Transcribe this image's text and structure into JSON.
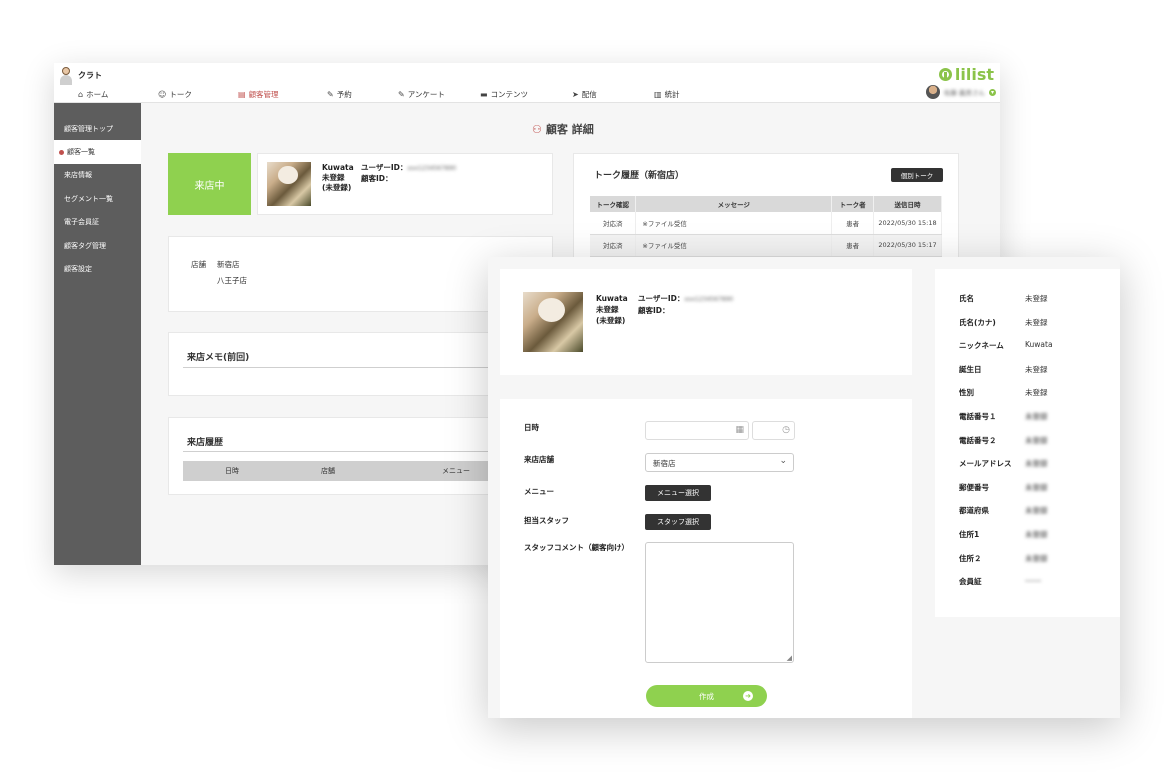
{
  "app": {
    "name": "クラト",
    "logo_text": "lilist",
    "user_name": "佐藤 義男さん"
  },
  "nav": [
    {
      "label": "ホーム",
      "icon": "home-icon",
      "glyph": "⌂"
    },
    {
      "label": "トーク",
      "icon": "chat-icon",
      "glyph": "☺"
    },
    {
      "label": "顧客管理",
      "icon": "customer-icon",
      "glyph": "▤"
    },
    {
      "label": "予約",
      "icon": "reservation-icon",
      "glyph": "✎"
    },
    {
      "label": "アンケート",
      "icon": "survey-icon",
      "glyph": "✎"
    },
    {
      "label": "コンテンツ",
      "icon": "folder-icon",
      "glyph": "▬"
    },
    {
      "label": "配信",
      "icon": "send-icon",
      "glyph": "➤"
    },
    {
      "label": "統計",
      "icon": "stats-icon",
      "glyph": "▥"
    }
  ],
  "sidebar": [
    "顧客管理トップ",
    "顧客一覧",
    "来店情報",
    "セグメント一覧",
    "電子会員証",
    "顧客タグ管理",
    "顧客設定"
  ],
  "page_title": "顧客 詳細",
  "visit_status_button": "来店中",
  "customer": {
    "name": "Kuwata",
    "registration_1": "未登録",
    "registration_2": "(未登録)",
    "user_id_label": "ユーザーID：",
    "user_id_value": "xxx1234567890",
    "customer_id_label": "顧客ID："
  },
  "store": {
    "label": "店舗",
    "values": [
      "新宿店",
      "八王子店"
    ]
  },
  "visit_memo_title": "来店メモ(前回)",
  "visit_history": {
    "title": "来店履歴",
    "columns": [
      "日時",
      "店舗",
      "メニュー"
    ]
  },
  "talk_history": {
    "title": "トーク履歴（新宿店）",
    "button": "個別トーク",
    "columns": [
      "トーク確認",
      "メッセージ",
      "トーク者",
      "送信日時"
    ],
    "rows": [
      {
        "status": "対応済",
        "message": "※ファイル受信",
        "sender": "患者",
        "datetime": "2022/05/30 15:18"
      },
      {
        "status": "対応済",
        "message": "※ファイル受信",
        "sender": "患者",
        "datetime": "2022/05/30 15:17"
      }
    ]
  },
  "visit_form": {
    "datetime_label": "日時",
    "store_label": "来店店舗",
    "store_value": "新宿店",
    "menu_label": "メニュー",
    "menu_button": "メニュー選択",
    "staff_label": "担当スタッフ",
    "staff_button": "スタッフ選択",
    "comment_label": "スタッフコメント（顧客向け）",
    "submit": "作成"
  },
  "profile": [
    {
      "key": "氏名",
      "value": "未登録",
      "blur": false
    },
    {
      "key": "氏名(カナ)",
      "value": "未登録",
      "blur": false
    },
    {
      "key": "ニックネーム",
      "value": "Kuwata",
      "blur": false
    },
    {
      "key": "誕生日",
      "value": "未登録",
      "blur": false
    },
    {
      "key": "性別",
      "value": "未登録",
      "blur": false
    },
    {
      "key": "電話番号１",
      "value": "未登録",
      "blur": true
    },
    {
      "key": "電話番号２",
      "value": "未登録",
      "blur": true
    },
    {
      "key": "メールアドレス",
      "value": "未登録",
      "blur": true
    },
    {
      "key": "郵便番号",
      "value": "未登録",
      "blur": true
    },
    {
      "key": "都道府県",
      "value": "未登録",
      "blur": true
    },
    {
      "key": "住所1",
      "value": "未登録",
      "blur": true
    },
    {
      "key": "住所２",
      "value": "未登録",
      "blur": true
    },
    {
      "key": "会員証",
      "value": "------",
      "blur": true
    }
  ],
  "colors": {
    "accent_green": "#8fd14f",
    "accent_red": "#c0504d",
    "sidebar_bg": "#5d5d5d"
  }
}
